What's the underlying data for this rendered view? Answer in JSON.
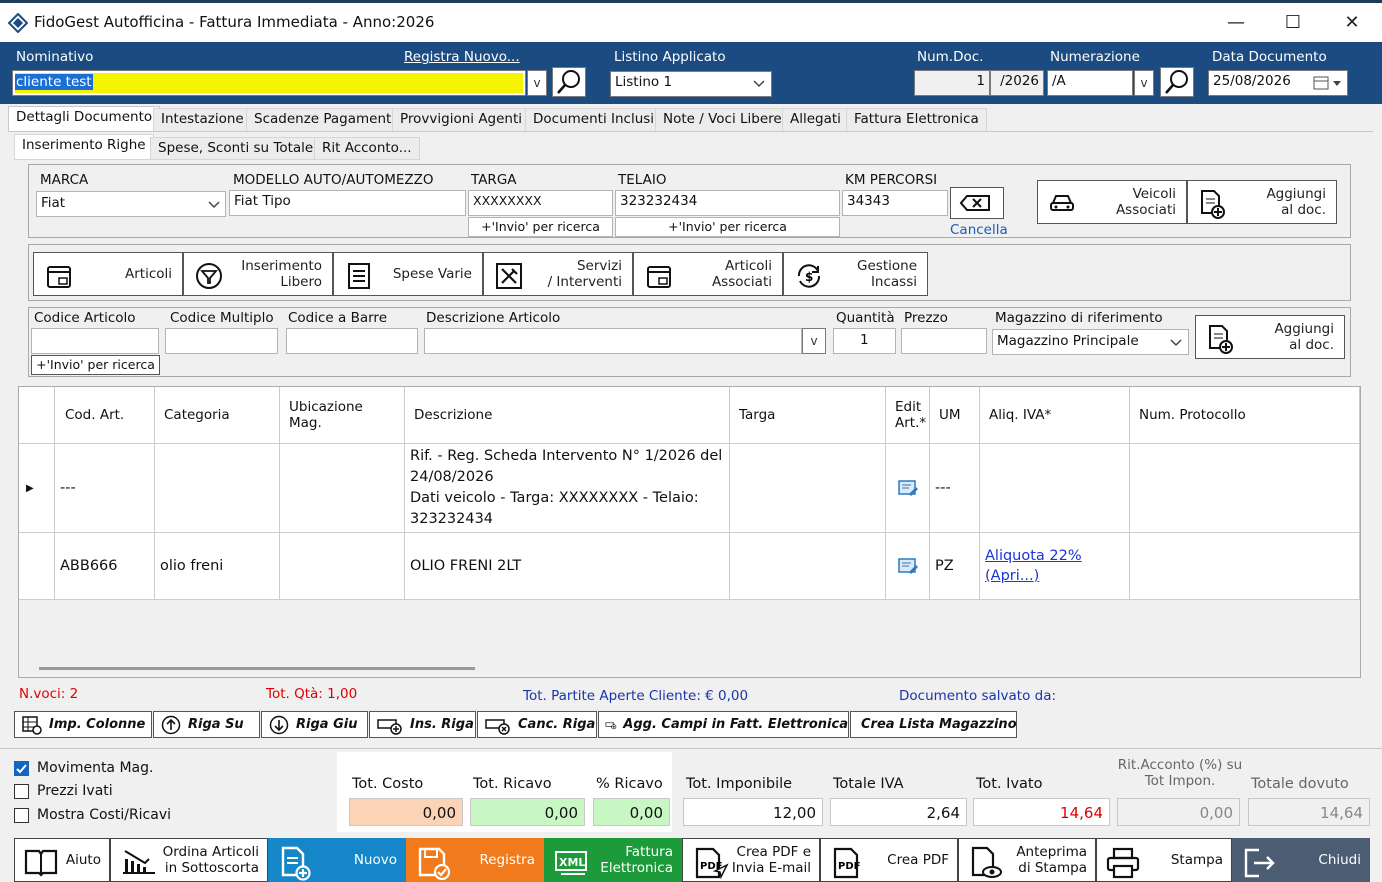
{
  "window": {
    "title": "FidoGest Autofficina - Fattura Immediata - Anno:2026",
    "min": "—",
    "max": "☐",
    "close": "✕"
  },
  "header": {
    "nominativo_label": "Nominativo",
    "registra_nuovo": "Registra Nuovo...",
    "nominativo_value": "cliente test",
    "listino_label": "Listino Applicato",
    "listino_value": "Listino 1",
    "numdoc_label": "Num.Doc.",
    "numdoc_value": "1",
    "numdoc_suffix": "/2026",
    "numerazione_label": "Numerazione",
    "numerazione_value": "/A",
    "data_label": "Data Documento",
    "data_value": "25/08/2026",
    "dd": "v"
  },
  "tabs": [
    "Dettagli Documento",
    "Intestazione",
    "Scadenze Pagamenti",
    "Provvigioni Agenti",
    "Documenti Inclusi",
    "Note / Voci Libere",
    "Allegati",
    "Fattura Elettronica"
  ],
  "subtabs": [
    "Inserimento Righe",
    "Spese, Sconti su Totale",
    "Rit Acconto..."
  ],
  "vehicle": {
    "marca_label": "MARCA",
    "marca_value": "Fiat",
    "modello_label": "MODELLO AUTO/AUTOMEZZO",
    "modello_value": "Fiat Tipo",
    "targa_label": "TARGA",
    "targa_value": "XXXXXXXX",
    "telaio_label": "TELAIO",
    "telaio_value": "323232434",
    "km_label": "KM PERCORSI",
    "km_value": "34343",
    "hint": "+'Invio' per ricerca",
    "cancella": "Cancella",
    "veicoli": "Veicoli\nAssociati",
    "aggiungi": "Aggiungi\nal doc."
  },
  "actions": [
    "Articoli",
    "Inserimento\nLibero",
    "Spese Varie",
    "Servizi\n/ Interventi",
    "Articoli\nAssociati",
    "Gestione\nIncassi"
  ],
  "articolo": {
    "codice_label": "Codice Articolo",
    "multiplo_label": "Codice Multiplo",
    "barre_label": "Codice a Barre",
    "descr_label": "Descrizione Articolo",
    "qta_label": "Quantità",
    "qta_value": "1",
    "prezzo_label": "Prezzo",
    "mag_label": "Magazzino di riferimento",
    "mag_value": "Magazzino Principale",
    "hint": "+'Invio' per ricerca",
    "aggiungi": "Aggiungi\nal doc.",
    "dd": "v"
  },
  "grid": {
    "columns": [
      "Cod. Art.",
      "Categoria",
      "Ubicazione\nMag.",
      "Descrizione",
      "Targa",
      "Edit\nArt.*",
      "UM",
      "Aliq. IVA*",
      "Num. Protocollo"
    ],
    "rows": [
      {
        "marker": "▶",
        "cod": "---",
        "categoria": "",
        "ubicazione": "",
        "descrizione": "Rif. - Reg. Scheda Intervento N° 1/2026 del 24/08/2026\nDati veicolo - Targa: XXXXXXXX - Telaio: 323232434",
        "targa": "",
        "um": "---",
        "iva": "",
        "protocollo": ""
      },
      {
        "marker": "",
        "cod": "ABB666",
        "categoria": "olio freni",
        "ubicazione": "",
        "descrizione": "OLIO FRENI 2LT",
        "targa": "",
        "um": "PZ",
        "iva": "Aliquota 22% (Apri...)",
        "protocollo": ""
      }
    ]
  },
  "status": {
    "nvoci": "N.voci: 2",
    "totqta": "Tot. Qtà: 1,00",
    "partite": "Tot. Partite Aperte Cliente: € 0,00",
    "salvato": "Documento salvato da:"
  },
  "toolbar": [
    "Imp. Colonne",
    "Riga Su",
    "Riga Giu",
    "Ins. Riga",
    "Canc. Riga",
    "Agg. Campi in Fatt. Elettronica",
    "Crea Lista Magazzino"
  ],
  "checks": [
    {
      "label": "Movimenta Mag.",
      "checked": true
    },
    {
      "label": "Prezzi Ivati",
      "checked": false
    },
    {
      "label": "Mostra Costi/Ricavi",
      "checked": false
    }
  ],
  "totals": {
    "costo_label": "Tot. Costo",
    "costo": "0,00",
    "ricavo_label": "Tot. Ricavo",
    "ricavo": "0,00",
    "pric_label": "% Ricavo",
    "pric": "0,00",
    "imp_label": "Tot. Imponibile",
    "imp": "12,00",
    "iva_label": "Totale IVA",
    "iva": "2,64",
    "ivato_label": "Tot. Ivato",
    "ivato": "14,64",
    "rit_label": "Rit.Acconto (%) su\nTot Impon.",
    "rit": "0,00",
    "dovuto_label": "Totale dovuto",
    "dovuto": "14,64"
  },
  "footer": [
    "Aiuto",
    "Ordina Articoli\nin Sottoscorta",
    "Nuovo",
    "Registra",
    "Fattura\nElettronica",
    "Crea PDF e\nInvia E-mail",
    "Crea PDF",
    "Anteprima\ndi Stampa",
    "Stampa",
    "Chiudi"
  ],
  "colors": {
    "header_bg": "#1b4b80",
    "nuovo": "#1586c8",
    "registra": "#f07a1c",
    "fattura": "#1d9a3a",
    "chiudi": "#4a5d73",
    "highlight": "#f5f500"
  }
}
